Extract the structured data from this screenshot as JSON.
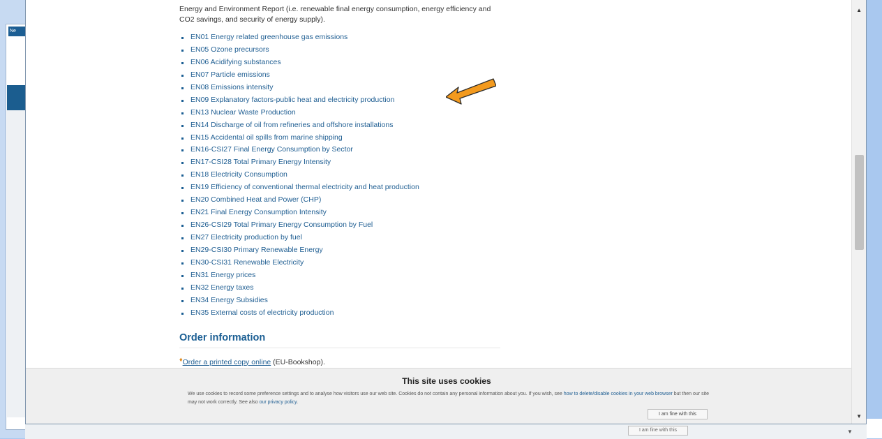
{
  "background": {
    "tab_label": "Ne",
    "bottom_button": "I am fine with this"
  },
  "intro_text": "Energy and Environment Report (i.e. renewable final energy consumption, energy efficiency and CO2 savings, and security of energy supply).",
  "indicators": [
    "EN01 Energy related greenhouse gas emissions",
    "EN05 Ozone precursors",
    "EN06 Acidifying substances",
    "EN07 Particle emissions",
    "EN08 Emissions intensity",
    "EN09 Explanatory factors-public heat and electricity production",
    "EN13 Nuclear Waste Production",
    "EN14 Discharge of oil from refineries and offshore installations",
    "EN15 Accidental oil spills from marine shipping",
    "EN16-CSI27 Final Energy Consumption by Sector",
    "EN17-CSI28 Total Primary Energy Intensity",
    "EN18 Electricity Consumption",
    "EN19 Efficiency of conventional thermal electricity and heat production",
    "EN20 Combined Heat and Power (CHP)",
    "EN21 Final Energy Consumption Intensity",
    "EN26-CSI29 Total Primary Energy Consumption by Fuel",
    "EN27 Electricity production by fuel",
    "EN29-CSI30 Primary Renewable Energy",
    "EN30-CSI31 Renewable Electricity",
    "EN31 Energy prices",
    "EN32 Energy taxes",
    "EN34 Energy Subsidies",
    "EN35 External costs of electricity production"
  ],
  "order": {
    "title": "Order information",
    "link_text": "Order a printed copy online",
    "suffix": " (EU-Bookshop)."
  },
  "cookie": {
    "title": "This site uses cookies",
    "text_1": "We use cookies to record some preference settings and to analyse how visitors use our web site. Cookies do not contain any personal information about you. If you wish, see ",
    "link_1": "how to delete/disable cookies in your web browser",
    "text_2": " but then our site may not work correctly. See also ",
    "link_2": "our privacy policy",
    "text_3": ".",
    "button": "I am fine with this"
  },
  "colors": {
    "link": "#1f5e92",
    "heading": "#1a5e93",
    "arrow": "#f39a1e",
    "outer_background": "#a9c8ef"
  }
}
